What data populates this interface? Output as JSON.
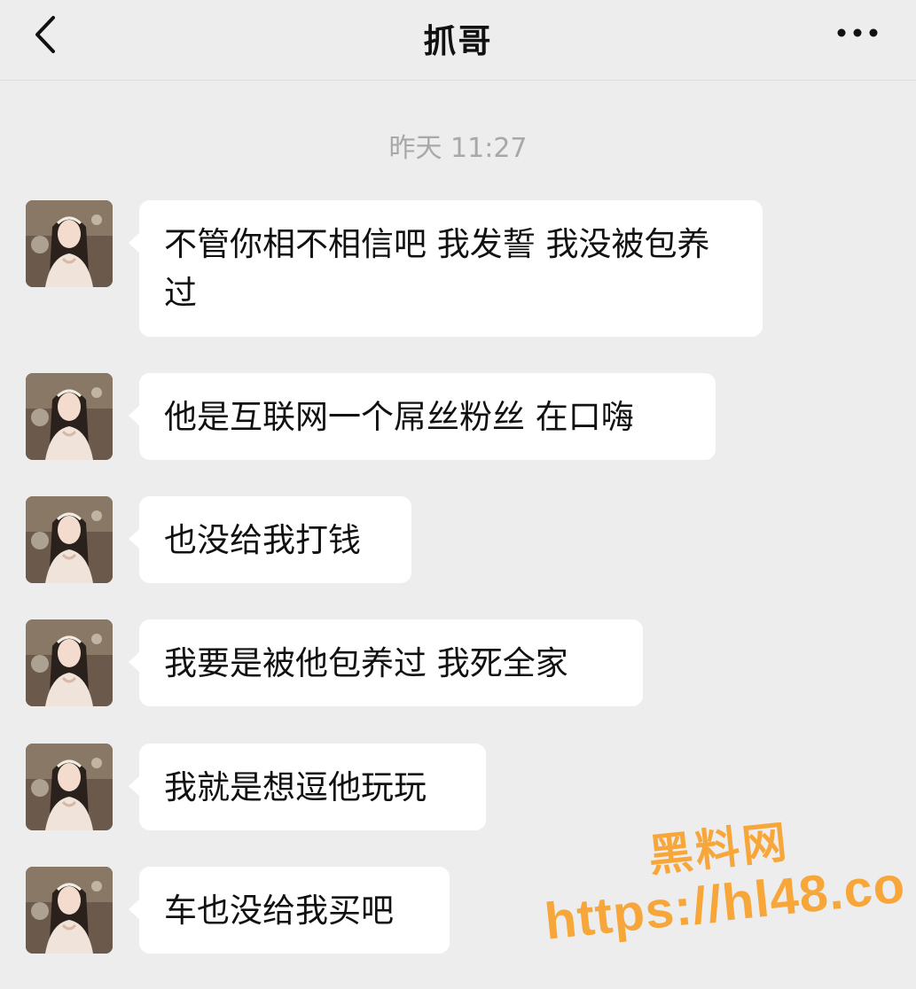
{
  "header": {
    "title": "抓哥"
  },
  "chat": {
    "timestamp": "昨天 11:27",
    "messages": [
      {
        "text": "不管你相不相信吧 我发誓 我没被包养过"
      },
      {
        "text": "他是互联网一个屌丝粉丝 在口嗨"
      },
      {
        "text": "也没给我打钱"
      },
      {
        "text": "我要是被他包养过 我死全家"
      },
      {
        "text": "我就是想逗他玩玩"
      },
      {
        "text": "车也没给我买吧"
      }
    ]
  },
  "watermark": {
    "name": "黑料网",
    "url": "https://hl48.co"
  },
  "icons": {
    "back": "chevron-left-icon",
    "more": "more-dots-icon"
  },
  "colors": {
    "background": "#ededed",
    "bubble": "#ffffff",
    "watermark": "#f7a63a"
  }
}
